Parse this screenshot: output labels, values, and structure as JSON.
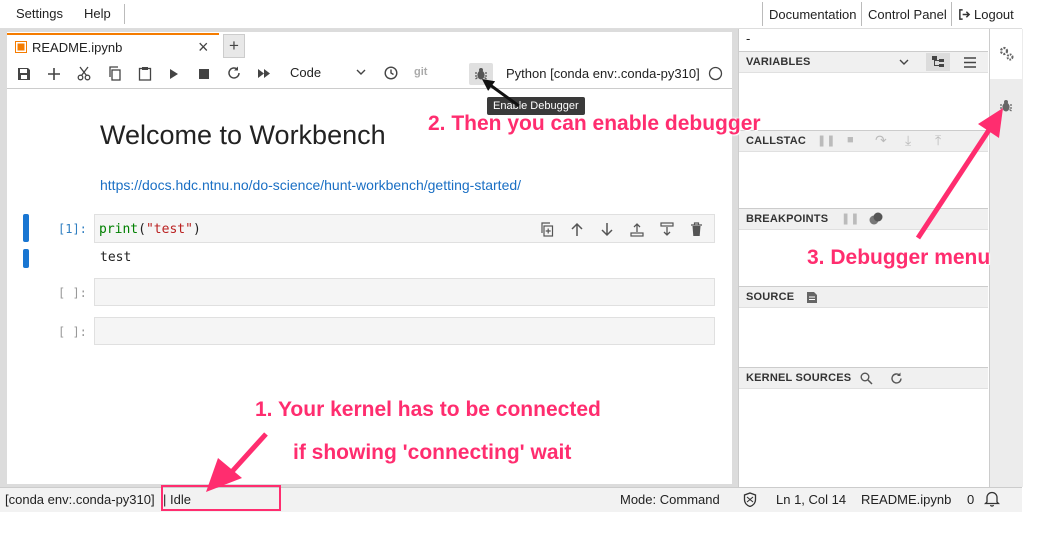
{
  "menu": {
    "settings": "Settings",
    "help": "Help"
  },
  "topbar": {
    "documentation": "Documentation",
    "control_panel": "Control Panel",
    "logout": "Logout"
  },
  "tab": {
    "title": "README.ipynb",
    "close": "×",
    "add": "+"
  },
  "toolbar": {
    "cell_type": "Code",
    "git": "git",
    "kernel_name": "Python [conda env:.conda-py310]"
  },
  "tooltip": "Enable Debugger",
  "notebook": {
    "heading": "Welcome to Workbench",
    "link": "https://docs.hdc.ntnu.no/do-science/hunt-workbench/getting-started/",
    "cells": [
      {
        "prompt": "[1]:",
        "code_fn": "print",
        "code_open": "(",
        "code_str": "\"test\"",
        "code_close": ")",
        "output": "test"
      },
      {
        "prompt": "[ ]:"
      },
      {
        "prompt": "[ ]:"
      }
    ]
  },
  "right_panel": {
    "dash": "-",
    "variables": "VARIABLES",
    "callstack": "CALLSTAC",
    "breakpoints": "BREAKPOINTS",
    "source": "SOURCE",
    "kernel_sources": "KERNEL SOURCES"
  },
  "statusbar": {
    "env": "[conda env:.conda-py310]",
    "state": "| Idle",
    "mode": "Mode: Command",
    "position": "Ln 1, Col 14",
    "file": "README.ipynb",
    "count": "0"
  },
  "annotations": {
    "step1_line1": "1. Your kernel has to be connected",
    "step1_line2": "if showing 'connecting' wait",
    "step2": "2. Then you can enable debugger",
    "step3": "3. Debugger menu"
  },
  "colors": {
    "accent": "#f57c00",
    "annotation": "#ff2d6f",
    "link": "#1a6fc4",
    "cell_marker": "#1976d2"
  }
}
